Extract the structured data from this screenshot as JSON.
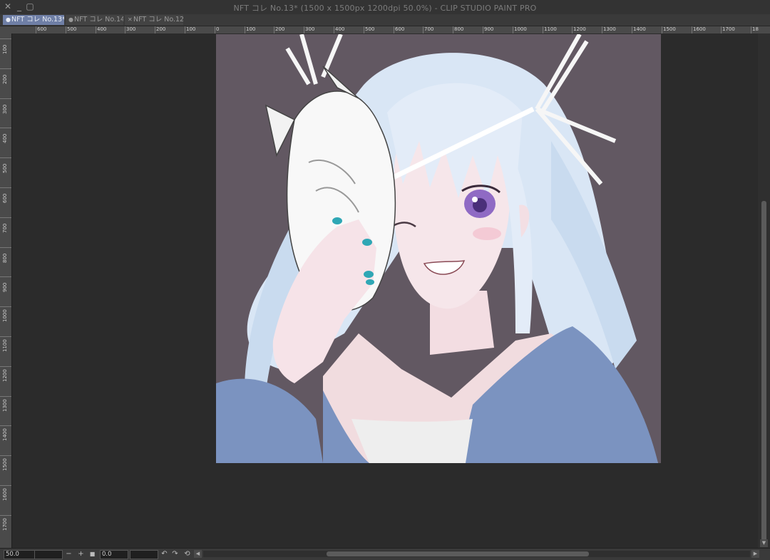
{
  "window": {
    "title": "NFT コレ No.13* (1500 x 1500px 1200dpi 50.0%)  - CLIP STUDIO PAINT PRO",
    "close_glyph": "✕",
    "minimize_glyph": "_",
    "maximize_glyph": "▢"
  },
  "tabs": [
    {
      "label": "NFT コレ No.13*",
      "mark": "●",
      "active": true
    },
    {
      "label": "NFT コレ No.14",
      "mark": "●",
      "active": false
    },
    {
      "label": "NFT コレ No.12",
      "mark": "✕",
      "active": false
    }
  ],
  "ruler_top": [
    "600",
    "500",
    "400",
    "300",
    "200",
    "100",
    "0",
    "100",
    "200",
    "300",
    "400",
    "500",
    "600",
    "700",
    "800",
    "900",
    "1000",
    "1100",
    "1200",
    "1300",
    "1400",
    "1500",
    "1600",
    "1700",
    "18"
  ],
  "ruler_left": [
    "100",
    "200",
    "300",
    "400",
    "500",
    "600",
    "700",
    "800",
    "900",
    "1000",
    "1100",
    "1200",
    "1300",
    "1400",
    "1500",
    "1600",
    "1700"
  ],
  "statusbar": {
    "zoom_value": "50.0",
    "rotation_value": "0.0",
    "zoom_out_glyph": "−",
    "zoom_in_glyph": "+",
    "fit_glyph": "■",
    "rotate_left_glyph": "↶",
    "rotate_right_glyph": "↷",
    "reset_glyph": "⟲"
  },
  "scrollbars": {
    "left_arrow": "◀",
    "right_arrow": "▶",
    "up_arrow": "▲",
    "down_arrow": "▼"
  },
  "colors": {
    "canvas_background": "#625862",
    "workspace": "#2b2b2b",
    "active_tab": "#6f7fa6",
    "hair": "#dfe9f6",
    "kimono": "#7b93c0",
    "eye": "#8f6ac4"
  }
}
